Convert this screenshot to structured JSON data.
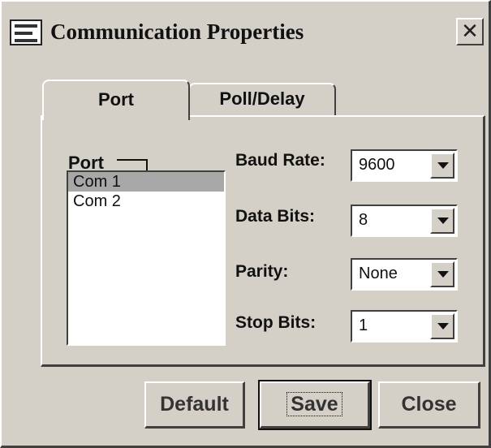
{
  "window": {
    "title": "Communication Properties",
    "close_symbol": "✕",
    "icon": "app-window-icon"
  },
  "tabs": [
    {
      "label": "Port",
      "selected": true
    },
    {
      "label": "Poll/Delay",
      "selected": false
    }
  ],
  "port_group": {
    "label": "Port",
    "items": [
      "Com 1",
      "Com 2"
    ],
    "selected_index": 0
  },
  "settings": {
    "baud_rate": {
      "label": "Baud Rate:",
      "value": "9600"
    },
    "data_bits": {
      "label": "Data Bits:",
      "value": "8"
    },
    "parity": {
      "label": "Parity:",
      "value": "None"
    },
    "stop_bits": {
      "label": "Stop Bits:",
      "value": "1"
    }
  },
  "buttons": {
    "default": "Default",
    "save": "Save",
    "close": "Close"
  },
  "colors": {
    "face": "#d4d0c8",
    "selection": "#a8a8a8"
  }
}
